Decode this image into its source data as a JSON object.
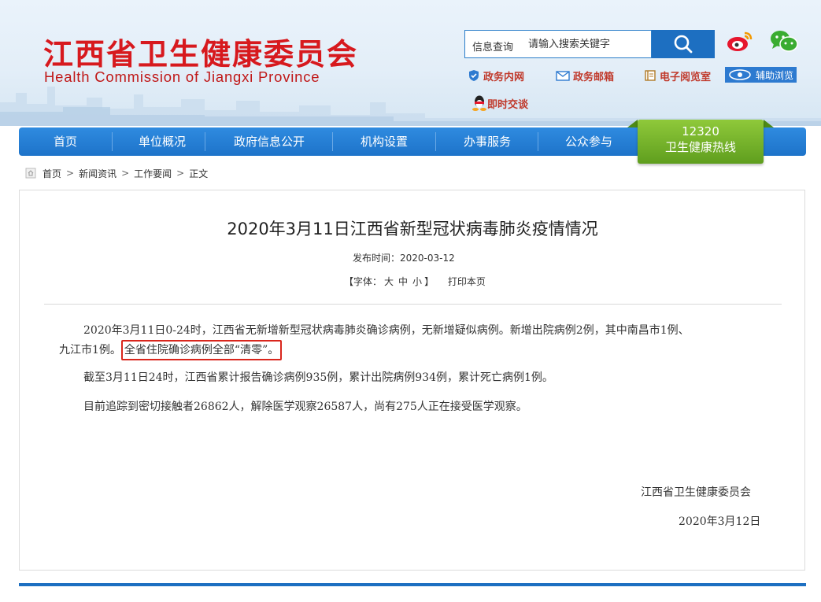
{
  "header": {
    "logo_cn": "江西省卫生健康委员会",
    "logo_en": "Health Commission of Jiangxi Province",
    "search": {
      "label": "信息查询",
      "placeholder": "请输入搜索关键字"
    },
    "links": {
      "intranet": "政务内网",
      "mail": "政务邮箱",
      "reading_room": "电子阅览室",
      "accessibility": "辅助浏览",
      "live_qa": "即时交谈"
    }
  },
  "nav": {
    "items": [
      "首页",
      "单位概况",
      "政府信息公开",
      "机构设置",
      "办事服务",
      "公众参与"
    ],
    "hotline": {
      "number": "12320",
      "label": "卫生健康热线"
    }
  },
  "breadcrumb": [
    "首页",
    "新闻资讯",
    "工作要闻",
    "正文"
  ],
  "article": {
    "title": "2020年3月11日江西省新型冠状病毒肺炎疫情情况",
    "pub_time": "发布时间：2020-03-12",
    "font_label": "【字体：",
    "font_large": "大",
    "font_medium": "中",
    "font_small": "小",
    "font_end": "】",
    "print": "打印本页",
    "p1_line1": "2020年3月11日0-24时，江西省无新增新型冠状病毒肺炎确诊病例，无新增疑似病例。新增出院病例2例，其中南昌市1例、",
    "p1_line2_a": "九江市1例。",
    "p1_line2_highlight": "全省住院确诊病例全部“清零”。",
    "p2": "截至3月11日24时，江西省累计报告确诊病例935例，累计出院病例934例，累计死亡病例1例。",
    "p3": "目前追踪到密切接触者26862人，解除医学观察26587人，尚有275人正在接受医学观察。",
    "signature_org": "江西省卫生健康委员会",
    "signature_date": "2020年3月12日"
  },
  "colors": {
    "brand_red": "#d7191e",
    "nav_blue": "#1d73c9",
    "hotline_green": "#6aab24",
    "highlight_red": "#d9261c"
  },
  "icons": [
    "search-icon",
    "weibo-icon",
    "wechat-icon",
    "shield-icon",
    "mail-icon",
    "book-icon",
    "eye-icon",
    "qq-icon",
    "home-icon"
  ]
}
